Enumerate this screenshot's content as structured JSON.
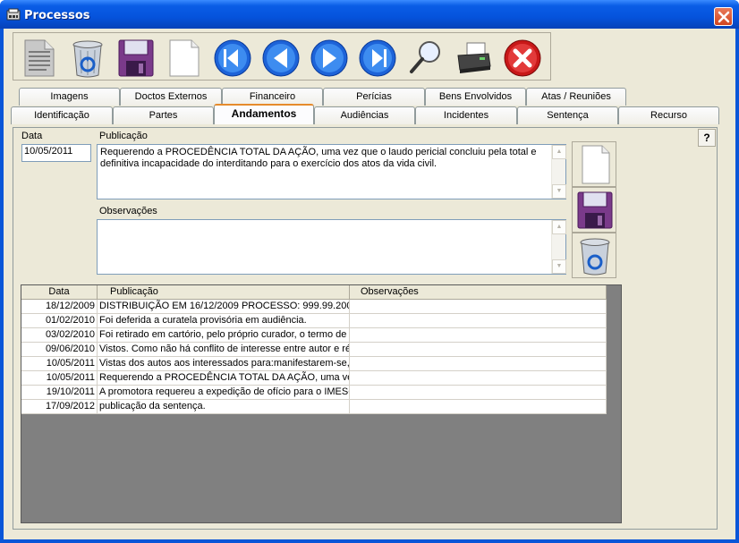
{
  "window": {
    "title": "Processos"
  },
  "toolbar": {
    "buttons": [
      "new-document-icon",
      "recycle-bin-icon",
      "save-floppy-icon",
      "blank-page-icon",
      "first-record-icon",
      "previous-record-icon",
      "next-record-icon",
      "last-record-icon",
      "search-magnifier-icon",
      "printer-icon",
      "cancel-icon"
    ]
  },
  "tabs": {
    "row1": [
      "Imagens",
      "Doctos Externos",
      "Financeiro",
      "Perícias",
      "Bens Envolvidos",
      "Atas / Reuniões"
    ],
    "row2": [
      "Identificação",
      "Partes",
      "Andamentos",
      "Audiências",
      "Incidentes",
      "Sentença",
      "Recurso"
    ],
    "active": "Andamentos"
  },
  "form": {
    "data_label": "Data",
    "data_value": "10/05/2011",
    "publicacao_label": "Publicação",
    "publicacao_value": "Requerendo a PROCEDÊNCIA TOTAL DA AÇÃO, uma vez que o laudo pericial concluiu pela total e definitiva incapacidade do interditando para o exercício dos atos da vida civil.",
    "observacoes_label": "Observações",
    "observacoes_value": "",
    "help_label": "?"
  },
  "grid": {
    "columns": [
      "Data",
      "Publicação",
      "Observações"
    ],
    "rows": [
      {
        "data": "18/12/2009",
        "publicacao": "DISTRIBUIÇÃO EM 16/12/2009 PROCESSO: 999.99.200",
        "obs": ""
      },
      {
        "data": "01/02/2010",
        "publicacao": "Foi deferida a curatela provisória em audiência.",
        "obs": ""
      },
      {
        "data": "03/02/2010",
        "publicacao": "Foi retirado em cartório, pelo próprio curador, o termo de re",
        "obs": ""
      },
      {
        "data": "09/06/2010",
        "publicacao": "Vistos. Como não há conflito de interesse entre autor e réu",
        "obs": ""
      },
      {
        "data": "10/05/2011",
        "publicacao": "Vistas dos autos aos interessados para:manifestarem-se, e",
        "obs": ""
      },
      {
        "data": "10/05/2011",
        "publicacao": "Requerendo a PROCEDÊNCIA TOTAL DA AÇÃO, uma ve",
        "obs": ""
      },
      {
        "data": "19/10/2011",
        "publicacao": "A promotora requereu a expedição de ofício para o IMESC",
        "obs": ""
      },
      {
        "data": "17/09/2012",
        "publicacao": "publicação da sentença.",
        "obs": ""
      }
    ]
  }
}
